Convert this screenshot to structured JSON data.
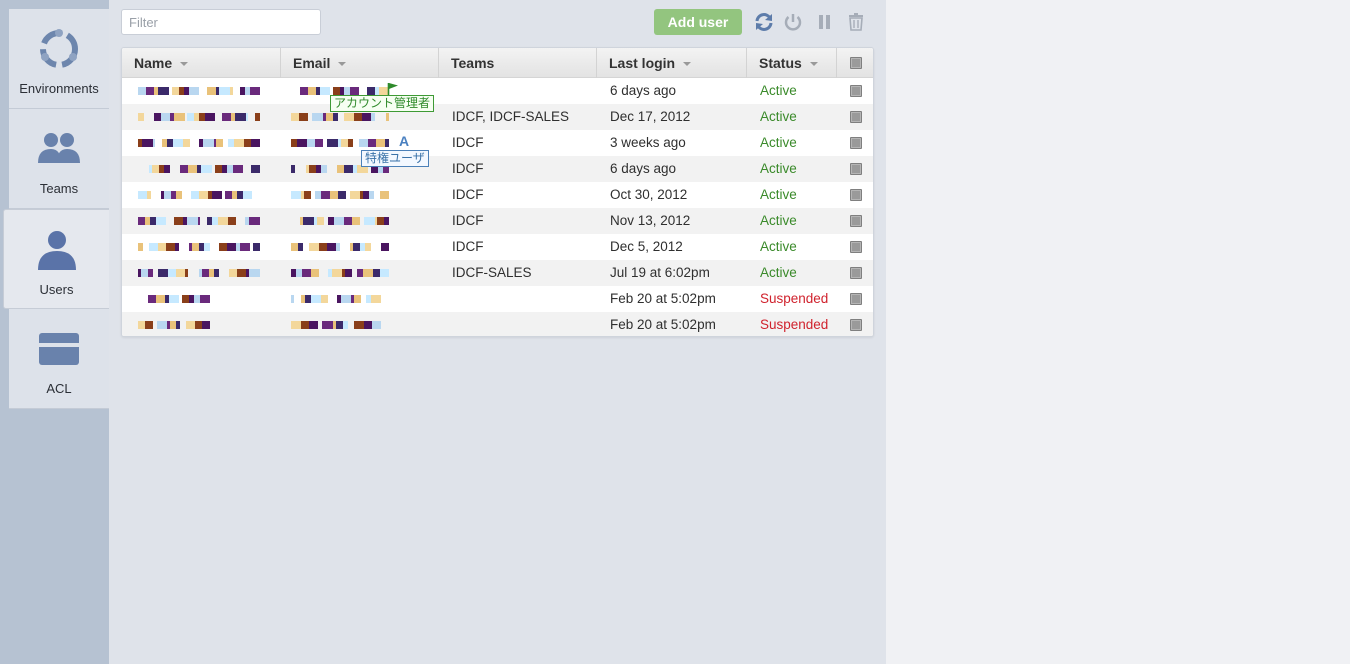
{
  "sidebar": {
    "items": [
      {
        "label": "Environments",
        "icon": "environments-icon",
        "active": false
      },
      {
        "label": "Teams",
        "icon": "teams-icon",
        "active": false
      },
      {
        "label": "Users",
        "icon": "user-icon",
        "active": true
      },
      {
        "label": "ACL",
        "icon": "acl-icon",
        "active": false
      }
    ]
  },
  "toolbar": {
    "filter_placeholder": "Filter",
    "add_user_label": "Add user",
    "tools": [
      "refresh-icon",
      "power-icon",
      "pause-icon",
      "trash-icon"
    ]
  },
  "table": {
    "columns": [
      {
        "label": "Name",
        "sortable": true
      },
      {
        "label": "Email",
        "sortable": true
      },
      {
        "label": "Teams",
        "sortable": false
      },
      {
        "label": "Last login",
        "sortable": true
      },
      {
        "label": "Status",
        "sortable": true
      }
    ],
    "rows": [
      {
        "teams": "",
        "last_login": "6 days ago",
        "status": "Active"
      },
      {
        "teams": "IDCF, IDCF-SALES",
        "last_login": "Dec 17, 2012",
        "status": "Active"
      },
      {
        "teams": "IDCF",
        "last_login": "3 weeks ago",
        "status": "Active"
      },
      {
        "teams": "IDCF",
        "last_login": "6 days ago",
        "status": "Active"
      },
      {
        "teams": "IDCF",
        "last_login": "Oct 30, 2012",
        "status": "Active"
      },
      {
        "teams": "IDCF",
        "last_login": "Nov 13, 2012",
        "status": "Active"
      },
      {
        "teams": "IDCF",
        "last_login": "Dec 5, 2012",
        "status": "Active"
      },
      {
        "teams": "IDCF-SALES",
        "last_login": "Jul 19 at 6:02pm",
        "status": "Active"
      },
      {
        "teams": "",
        "last_login": "Feb 20 at 5:02pm",
        "status": "Suspended"
      },
      {
        "teams": "",
        "last_login": "Feb 20 at 5:02pm",
        "status": "Suspended"
      }
    ]
  },
  "badges": {
    "account_admin": "アカウント管理者",
    "privileged_user": "特権ユーザ",
    "privileged_marker": "A"
  },
  "colors": {
    "active": "#3a8a2a",
    "suspended": "#d0222d",
    "add_button": "#93c57f",
    "icon_blue": "#5d7caa"
  }
}
